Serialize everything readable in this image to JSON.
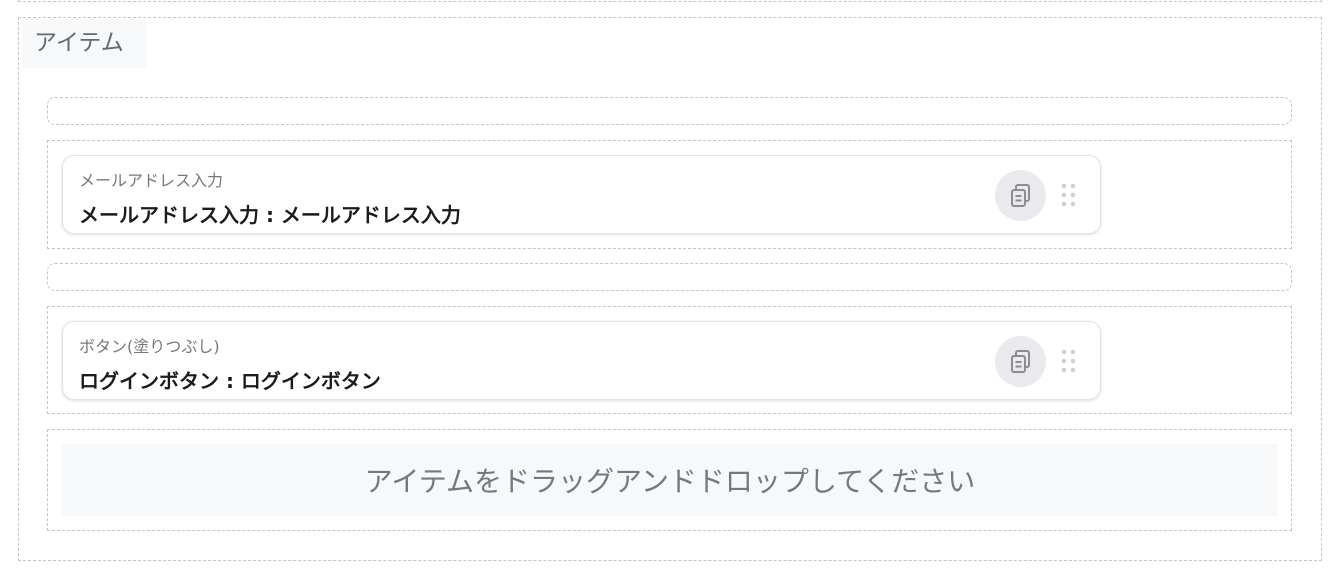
{
  "section": {
    "title": "アイテム"
  },
  "items": [
    {
      "type": "メールアドレス入力",
      "name": "メールアドレス入力 : メールアドレス入力",
      "copy_icon": "copy-icon",
      "drag_icon": "drag-handle-icon"
    },
    {
      "type": "ボタン(塗りつぶし)",
      "name": "ログインボタン : ログインボタン",
      "copy_icon": "copy-icon",
      "drag_icon": "drag-handle-icon"
    }
  ],
  "drop_zone": {
    "text": "アイテムをドラッグアンドドロップしてください"
  },
  "colors": {
    "border": "#c4c4c4",
    "icon": "#8a8d92",
    "icon_bg": "#e9e9ee",
    "zone_bg": "#f7f8fa"
  }
}
